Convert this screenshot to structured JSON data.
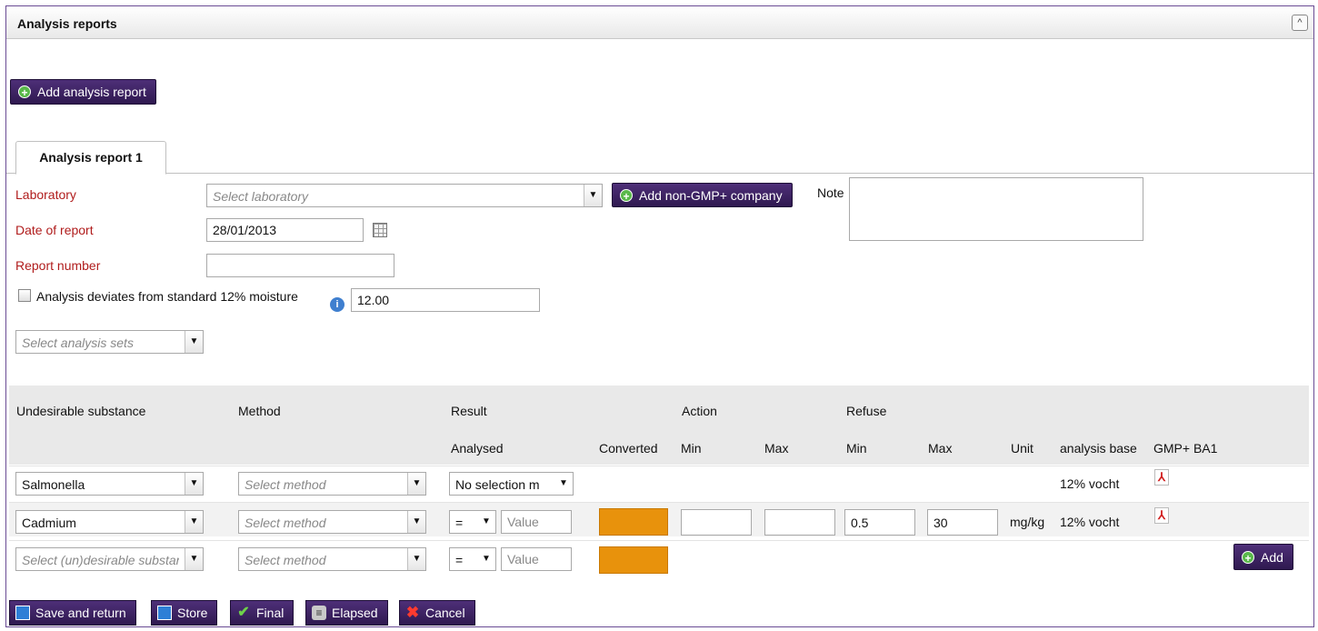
{
  "panel": {
    "title": "Analysis reports",
    "collapse_icon": "^"
  },
  "add_report_label": "Add analysis report",
  "tab_label": "Analysis report 1",
  "form": {
    "laboratory_label": "Laboratory",
    "laboratory_placeholder": "Select laboratory",
    "add_company_label": "Add non-GMP+ company",
    "note_label": "Note",
    "date_label": "Date of report",
    "date_value": "28/01/2013",
    "report_number_label": "Report number",
    "moisture_label": "Analysis deviates from standard 12% moisture",
    "moisture_value": "12.00",
    "analysis_sets_placeholder": "Select analysis sets"
  },
  "table": {
    "headers": {
      "substance": "Undesirable substance",
      "method": "Method",
      "result": "Result",
      "action": "Action",
      "refuse": "Refuse",
      "analysed": "Analysed",
      "converted": "Converted",
      "action_min": "Min",
      "action_max": "Max",
      "refuse_min": "Min",
      "refuse_max": "Max",
      "unit": "Unit",
      "analysis_base": "analysis base",
      "gmp_ba1": "GMP+ BA1"
    },
    "rows": [
      {
        "substance": "Salmonella",
        "method": "Select method",
        "analysed": "No selection m",
        "analysis_base": "12% vocht"
      },
      {
        "substance": "Cadmium",
        "method": "Select method",
        "operator": "=",
        "value_placeholder": "Value",
        "refuse_min": "0.5",
        "refuse_max": "30",
        "unit": "mg/kg",
        "analysis_base": "12% vocht"
      },
      {
        "substance": "Select (un)desirable substance",
        "method": "Select method",
        "operator": "=",
        "value_placeholder": "Value",
        "add_label": "Add"
      }
    ],
    "converted_color": "#e8920c"
  },
  "footer": {
    "save_return": "Save and return",
    "store": "Store",
    "final": "Final",
    "elapsed": "Elapsed",
    "cancel": "Cancel"
  },
  "colors": {
    "accent": "#3d2263",
    "required_label": "#b01c1c"
  }
}
